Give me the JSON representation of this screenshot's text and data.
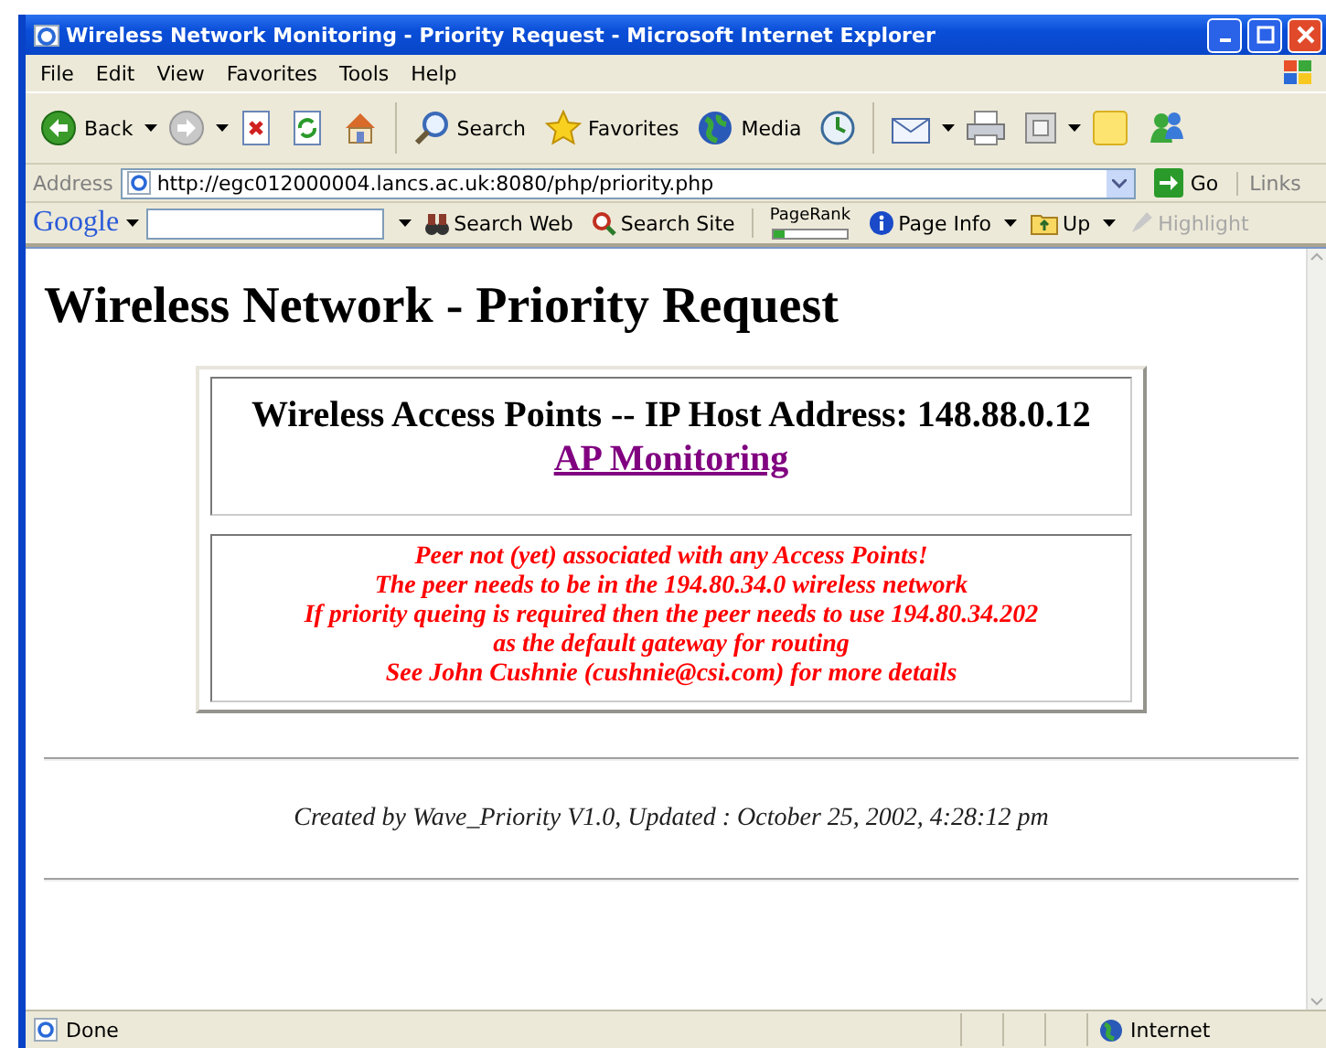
{
  "window": {
    "title": "Wireless Network Monitoring - Priority Request - Microsoft Internet Explorer"
  },
  "menu": [
    "File",
    "Edit",
    "View",
    "Favorites",
    "Tools",
    "Help"
  ],
  "toolbar": [
    {
      "kind": "back",
      "label": "Back"
    },
    {
      "kind": "forward"
    },
    {
      "kind": "stop"
    },
    {
      "kind": "refresh"
    },
    {
      "kind": "home"
    },
    {
      "kind": "search",
      "label": "Search"
    },
    {
      "kind": "favorites",
      "label": "Favorites"
    },
    {
      "kind": "media",
      "label": "Media"
    },
    {
      "kind": "history"
    },
    {
      "kind": "mail"
    },
    {
      "kind": "print"
    },
    {
      "kind": "edit"
    },
    {
      "kind": "note"
    },
    {
      "kind": "messenger"
    }
  ],
  "address": {
    "label": "Address",
    "url": "http://egc012000004.lancs.ac.uk:8080/php/priority.php",
    "go": "Go",
    "links": "Links"
  },
  "google_bar": {
    "logo": "Google",
    "items": [
      {
        "kind": "search-web",
        "label": "Search Web",
        "disabled": false
      },
      {
        "kind": "search-site",
        "label": "Search Site",
        "disabled": false
      },
      {
        "kind": "pagerank",
        "label": "PageRank",
        "disabled": false
      },
      {
        "kind": "page-info",
        "label": "Page Info",
        "disabled": false
      },
      {
        "kind": "up",
        "label": "Up",
        "disabled": false
      },
      {
        "kind": "highlight",
        "label": "Highlight",
        "disabled": true
      }
    ]
  },
  "page": {
    "heading": "Wireless Network - Priority Request",
    "panel_title": "Wireless Access Points -- IP Host Address: 148.88.0.12",
    "link": "AP Monitoring",
    "messages": [
      "Peer not (yet) associated with any Access Points!",
      "The peer needs to be in the 194.80.34.0 wireless network",
      "If priority queing is required then the peer needs to use 194.80.34.202",
      "as the default gateway for routing",
      "See John Cushnie (cushnie@csi.com) for more details"
    ],
    "footer": "Created by Wave_Priority V1.0, Updated : October 25, 2002, 4:28:12 pm"
  },
  "status_bar": {
    "text": "Done",
    "zone": "Internet"
  }
}
